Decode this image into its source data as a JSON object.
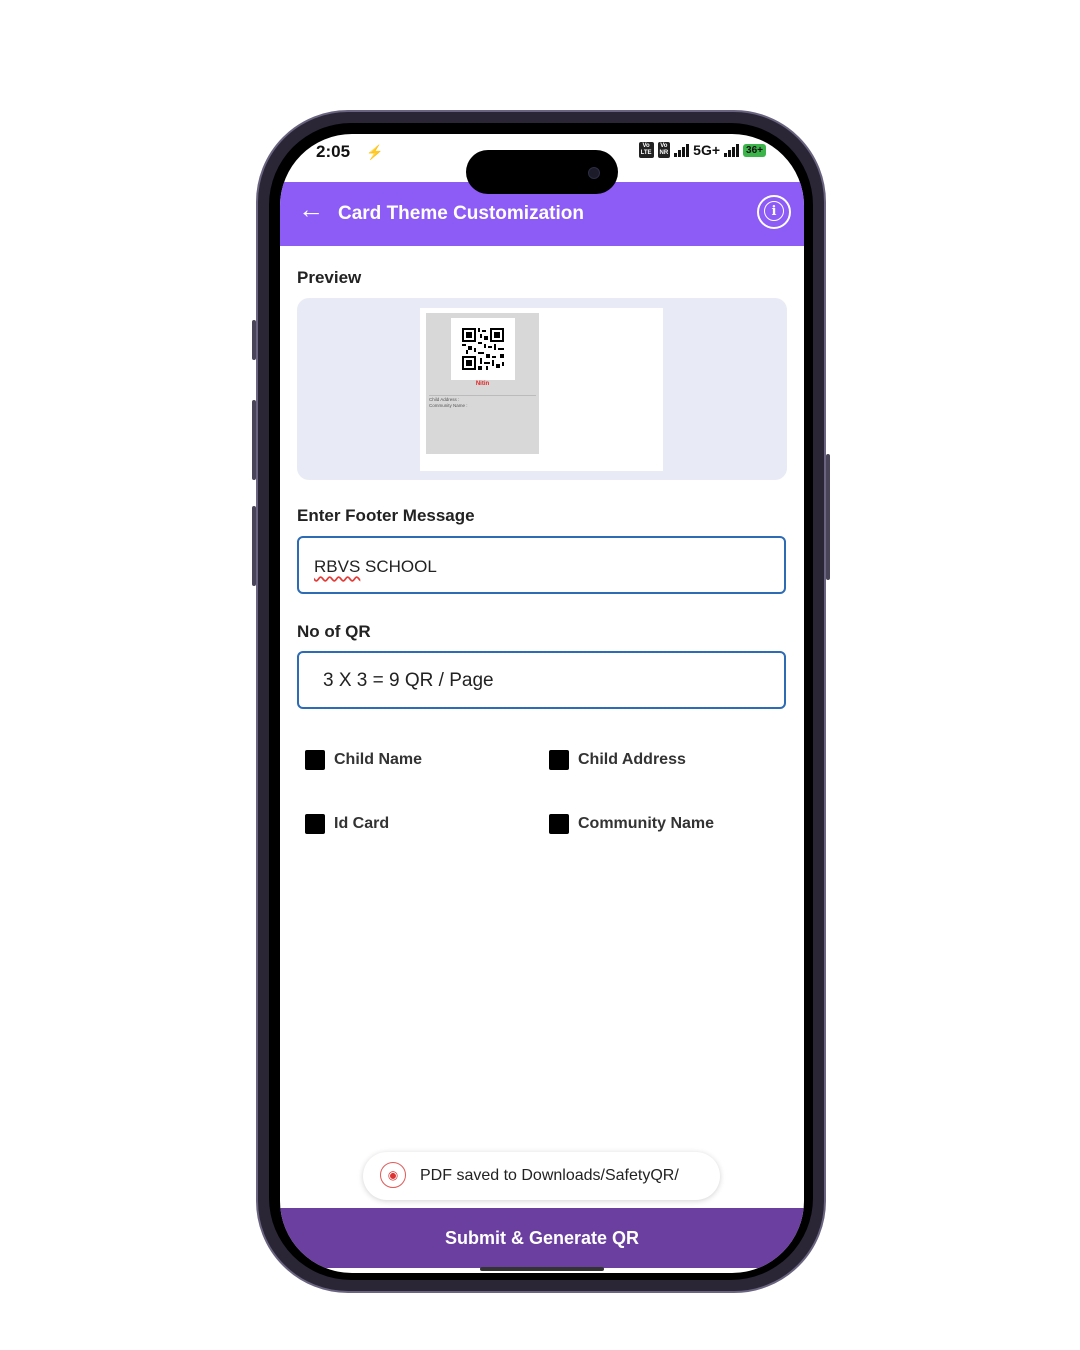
{
  "status_bar": {
    "time": "2:05",
    "bolt": "⚡",
    "sim1": "Vo\nLTE",
    "sim2": "Vo\nNR",
    "network": "5G+",
    "battery": "36+"
  },
  "header": {
    "title": "Card Theme Customization",
    "back_icon": "←",
    "info_icon": "i"
  },
  "preview": {
    "label": "Preview",
    "card": {
      "name": "Nitin",
      "lines": [
        "Child Address :",
        "Community Name :"
      ]
    }
  },
  "footer_message": {
    "label": "Enter Footer Message",
    "value": "RBVS SCHOOL",
    "value_flagged": "RBVS",
    "value_rest": " SCHOOL"
  },
  "qr_count": {
    "label": "No of QR",
    "selected": "3 X 3 = 9 QR / Page"
  },
  "options": [
    {
      "label": "Child Name",
      "checked": true
    },
    {
      "label": "Child Address",
      "checked": true
    },
    {
      "label": "Id Card",
      "checked": true
    },
    {
      "label": "Community Name",
      "checked": true
    }
  ],
  "toast": {
    "text": "PDF saved to Downloads/SafetyQR/"
  },
  "submit_label": "Submit & Generate QR",
  "colors": {
    "accent": "#8d5cf6",
    "submit": "#6b3fa0",
    "input_border": "#2e6bb5"
  }
}
